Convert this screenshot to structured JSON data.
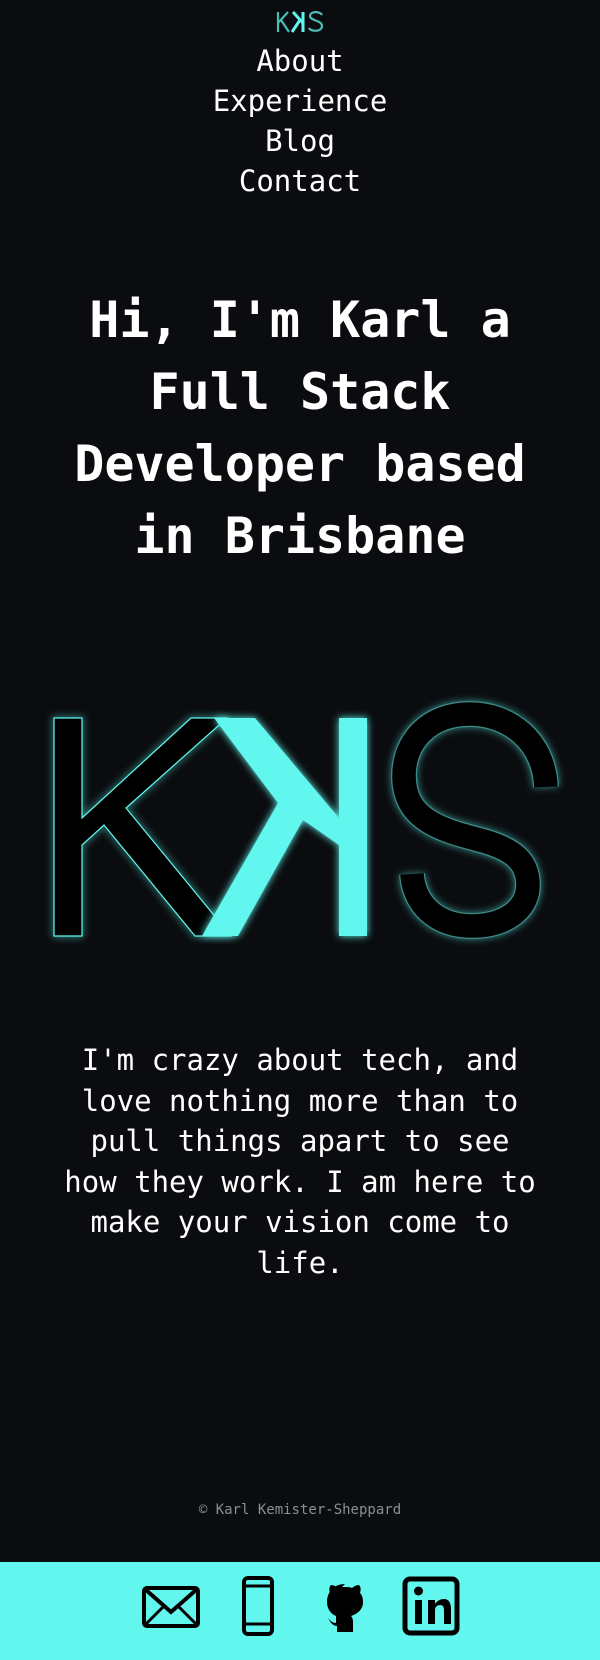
{
  "brand": {
    "logo_text": "KKS",
    "accent_color": "#62f7ee",
    "background_color": "#0a0c0f"
  },
  "nav": {
    "links": [
      {
        "label": "About"
      },
      {
        "label": "Experience"
      },
      {
        "label": "Blog"
      },
      {
        "label": "Contact"
      }
    ]
  },
  "hero": {
    "title": "Hi, I'm Karl a Full Stack Developer based in Brisbane"
  },
  "intro": {
    "text": "I'm crazy about tech, and love nothing more than to pull things apart to see how they work. I am here to make your vision come to life."
  },
  "footer": {
    "copyright": "© Karl Kemister-Sheppard",
    "icons": [
      "email-icon",
      "phone-icon",
      "github-icon",
      "linkedin-icon"
    ]
  }
}
